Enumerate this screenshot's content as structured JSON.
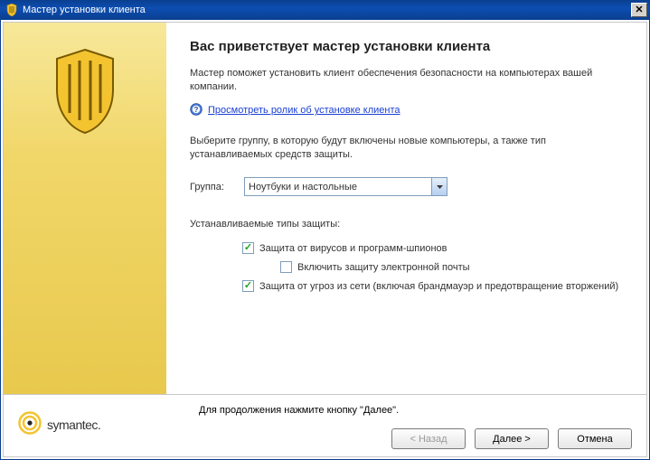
{
  "window": {
    "title": "Мастер установки клиента"
  },
  "page": {
    "heading": "Вас приветствует мастер установки клиента",
    "intro": "Мастер поможет установить клиент обеспечения безопасности на компьютерах вашей компании.",
    "help_link": "Просмотреть ролик об установке клиента",
    "instruction": "Выберите группу, в которую будут включены новые компьютеры, а также тип устанавливаемых средств защиты.",
    "group_label": "Группа:",
    "group_value": "Ноутбуки и настольные",
    "types_label": "Устанавливаемые типы защиты:",
    "cb_virus": "Защита от вирусов и программ-шпионов",
    "cb_email": "Включить защиту электронной почты",
    "cb_network": "Защита от угроз из сети (включая брандмауэр и предотвращение вторжений)"
  },
  "footer": {
    "hint": "Для продолжения нажмите кнопку \"Далее\".",
    "brand": "symantec.",
    "back": "< Назад",
    "next": "Далее >",
    "cancel": "Отмена"
  }
}
